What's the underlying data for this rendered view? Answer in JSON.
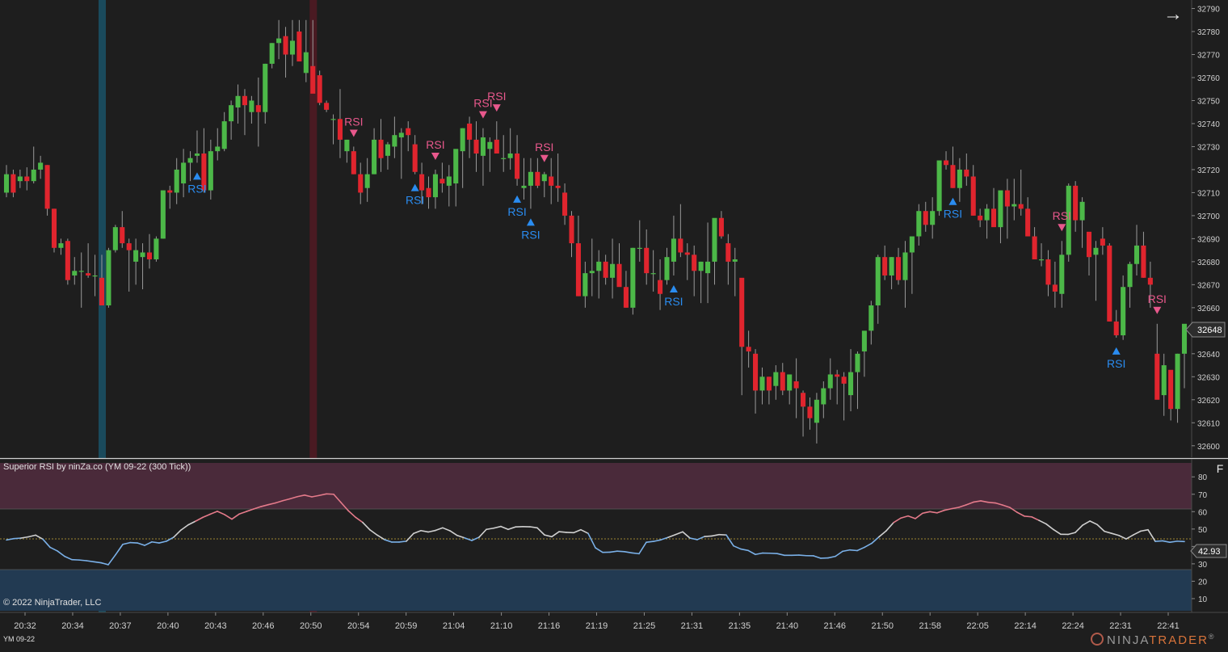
{
  "price_panel": {
    "y_ticks": [
      "32600",
      "32610",
      "32620",
      "32630",
      "32640",
      "32650",
      "32660",
      "32670",
      "32680",
      "32690",
      "32700",
      "32710",
      "32720",
      "32730",
      "32740",
      "32750",
      "32760",
      "32770",
      "32780",
      "32790"
    ],
    "current_price": "32648",
    "highlight_bands": [
      {
        "at_bar": 14,
        "color": "#1a4a5c"
      },
      {
        "at_bar": 45,
        "color": "#4a1a22"
      }
    ]
  },
  "indicator_panel": {
    "title": "Superior RSI by ninZa.co (YM 09-22 (300 Tick))",
    "y_ticks": [
      "10",
      "20",
      "30",
      "40",
      "50",
      "60",
      "70",
      "80"
    ],
    "current_value": "42.93",
    "overbought": 70,
    "oversold": 30,
    "midline": 50
  },
  "x_ticks": [
    "20:32",
    "20:34",
    "20:37",
    "20:40",
    "20:43",
    "20:46",
    "20:50",
    "20:54",
    "20:59",
    "21:04",
    "21:10",
    "21:16",
    "21:19",
    "21:25",
    "21:31",
    "21:35",
    "21:40",
    "21:46",
    "21:50",
    "21:58",
    "22:05",
    "22:14",
    "22:24",
    "22:31",
    "22:41"
  ],
  "signal_label": "RSI",
  "copyright": "© 2022 NinjaTrader, LLC",
  "instrument": "YM 09-22",
  "brand": {
    "main": "NINJA",
    "accent": "TRADER",
    "mark": "®"
  },
  "buttons": {
    "f_label": "F",
    "nav_arrow": "→"
  },
  "colors": {
    "up": "#4cb848",
    "down": "#e0252e",
    "buy_signal": "#2a8cf0",
    "sell_signal": "#e8588c",
    "rsi_high": "#e47a8a",
    "rsi_low": "#7ab0e8"
  },
  "chart_data": {
    "type": "candlestick",
    "series_price": {
      "name": "YM 09-22",
      "ohlc": [
        [
          32710,
          32722,
          32708,
          32718
        ],
        [
          32718,
          32720,
          32708,
          32710
        ],
        [
          32715,
          32720,
          32712,
          32717
        ],
        [
          32717,
          32721,
          32711,
          32715
        ],
        [
          32715,
          32730,
          32714,
          32720
        ],
        [
          32720,
          32726,
          32716,
          32723
        ],
        [
          32722,
          32722,
          32700,
          32703
        ],
        [
          32703,
          32703,
          32684,
          32686
        ],
        [
          32686,
          32690,
          32683,
          32688
        ],
        [
          32689,
          32690,
          32670,
          32672
        ],
        [
          32674,
          32682,
          32670,
          32676
        ],
        [
          32676,
          32684,
          32660,
          32676
        ],
        [
          32675,
          32688,
          32673,
          32674
        ],
        [
          32674,
          32683,
          32665,
          32674
        ],
        [
          32673,
          32683,
          32665,
          32661
        ],
        [
          32661,
          32686,
          32660,
          32685
        ],
        [
          32685,
          32696,
          32684,
          32695
        ],
        [
          32695,
          32702,
          32686,
          32688
        ],
        [
          32688,
          32690,
          32667,
          32685
        ],
        [
          32680,
          32690,
          32670,
          32685
        ],
        [
          32682,
          32688,
          32668,
          32684
        ],
        [
          32684,
          32692,
          32677,
          32681
        ],
        [
          32681,
          32691,
          32680,
          32690
        ],
        [
          32690,
          32711,
          32690,
          32711
        ],
        [
          32711,
          32713,
          32703,
          32710
        ],
        [
          32710,
          32725,
          32705,
          32720
        ],
        [
          32714,
          32729,
          32708,
          32723
        ],
        [
          32723,
          32728,
          32715,
          32725
        ],
        [
          32726,
          32737,
          32723,
          32727
        ],
        [
          32727,
          32738,
          32710,
          32711
        ],
        [
          32711,
          32733,
          32707,
          32728
        ],
        [
          32728,
          32738,
          32724,
          32730
        ],
        [
          32729,
          32745,
          32728,
          32741
        ],
        [
          32741,
          32750,
          32733,
          32748
        ],
        [
          32747,
          32757,
          32740,
          32752
        ],
        [
          32752,
          32755,
          32735,
          32748
        ],
        [
          32745,
          32752,
          32740,
          32750
        ],
        [
          32748,
          32760,
          32730,
          32745
        ],
        [
          32745,
          32766,
          32740,
          32766
        ],
        [
          32766,
          32775,
          32764,
          32775
        ],
        [
          32775,
          32785,
          32768,
          32777
        ],
        [
          32778,
          32782,
          32760,
          32770
        ],
        [
          32770,
          32785,
          32765,
          32776
        ],
        [
          32780,
          32785,
          32768,
          32767
        ],
        [
          32762,
          32785,
          32758,
          32771
        ],
        [
          32765,
          32785,
          32757,
          32753
        ],
        [
          32761,
          32763,
          32748,
          32749
        ],
        [
          32749,
          32750,
          32745,
          32746
        ],
        [
          32742,
          32744,
          32731,
          32742
        ],
        [
          32742,
          32755,
          32725,
          32733
        ],
        [
          32728,
          32733,
          32723,
          32733
        ],
        [
          32728,
          32730,
          32718,
          32718
        ],
        [
          32718,
          32723,
          32705,
          32710
        ],
        [
          32712,
          32725,
          32706,
          32718
        ],
        [
          32718,
          32738,
          32718,
          32733
        ],
        [
          32733,
          32742,
          32719,
          32725
        ],
        [
          32726,
          32732,
          32720,
          32731
        ],
        [
          32730,
          32743,
          32725,
          32735
        ],
        [
          32734,
          32738,
          32716,
          32736
        ],
        [
          32738,
          32741,
          32728,
          32735
        ],
        [
          32731,
          32735,
          32718,
          32719
        ],
        [
          32718,
          32723,
          32705,
          32711
        ],
        [
          32712,
          32717,
          32703,
          32708
        ],
        [
          32708,
          32720,
          32703,
          32718
        ],
        [
          32716,
          32723,
          32710,
          32714
        ],
        [
          32713,
          32722,
          32704,
          32717
        ],
        [
          32714,
          32727,
          32704,
          32729
        ],
        [
          32728,
          32738,
          32712,
          32738
        ],
        [
          32740,
          32743,
          32725,
          32733
        ],
        [
          32733,
          32741,
          32719,
          32727
        ],
        [
          32726,
          32738,
          32713,
          32734
        ],
        [
          32729,
          32734,
          32719,
          32732
        ],
        [
          32733,
          32741,
          32729,
          32727
        ],
        [
          32725,
          32735,
          32719,
          32725
        ],
        [
          32725,
          32738,
          32720,
          32727
        ],
        [
          32727,
          32735,
          32713,
          32716
        ],
        [
          32712,
          32725,
          32707,
          32713
        ],
        [
          32713,
          32725,
          32703,
          32719
        ],
        [
          32719,
          32725,
          32712,
          32713
        ],
        [
          32715,
          32719,
          32708,
          32718
        ],
        [
          32717,
          32725,
          32705,
          32713
        ],
        [
          32713,
          32727,
          32706,
          32712
        ],
        [
          32710,
          32714,
          32696,
          32700
        ],
        [
          32700,
          32702,
          32682,
          32688
        ],
        [
          32688,
          32700,
          32665,
          32665
        ],
        [
          32665,
          32680,
          32660,
          32675
        ],
        [
          32675,
          32690,
          32665,
          32676
        ],
        [
          32676,
          32685,
          32664,
          32680
        ],
        [
          32680,
          32683,
          32670,
          32673
        ],
        [
          32673,
          32690,
          32664,
          32679
        ],
        [
          32679,
          32688,
          32670,
          32669
        ],
        [
          32669,
          32676,
          32660,
          32660
        ],
        [
          32660,
          32686,
          32657,
          32686
        ],
        [
          32686,
          32698,
          32680,
          32686
        ],
        [
          32686,
          32694,
          32670,
          32675
        ],
        [
          32675,
          32685,
          32667,
          32675
        ],
        [
          32672,
          32681,
          32659,
          32666
        ],
        [
          32672,
          32686,
          32670,
          32682
        ],
        [
          32680,
          32700,
          32674,
          32690
        ],
        [
          32690,
          32705,
          32682,
          32684
        ],
        [
          32684,
          32688,
          32672,
          32683
        ],
        [
          32683,
          32687,
          32665,
          32676
        ],
        [
          32676,
          32680,
          32662,
          32680
        ],
        [
          32675,
          32697,
          32662,
          32680
        ],
        [
          32680,
          32696,
          32670,
          32699
        ],
        [
          32699,
          32702,
          32690,
          32691
        ],
        [
          32688,
          32692,
          32670,
          32680
        ],
        [
          32680,
          32686,
          32665,
          32681
        ],
        [
          32673,
          32670,
          32622,
          32643
        ],
        [
          32643,
          32650,
          32634,
          32641
        ],
        [
          32640,
          32642,
          32614,
          32624
        ],
        [
          32624,
          32634,
          32618,
          32630
        ],
        [
          32630,
          32630,
          32618,
          32624
        ],
        [
          32626,
          32635,
          32620,
          32632
        ],
        [
          32632,
          32636,
          32622,
          32624
        ],
        [
          32624,
          32628,
          32618,
          32631
        ],
        [
          32628,
          32638,
          32612,
          32625
        ],
        [
          32623,
          32624,
          32604,
          32617
        ],
        [
          32617,
          32621,
          32607,
          32612
        ],
        [
          32610,
          32623,
          32601,
          32620
        ],
        [
          32618,
          32628,
          32612,
          32625
        ],
        [
          32625,
          32638,
          32620,
          32631
        ],
        [
          32631,
          32633,
          32618,
          32630
        ],
        [
          32630,
          32632,
          32611,
          32627
        ],
        [
          32622,
          32642,
          32615,
          32632
        ],
        [
          32632,
          32641,
          32616,
          32640
        ],
        [
          32641,
          32648,
          32630,
          32650
        ],
        [
          32650,
          32663,
          32644,
          32661
        ],
        [
          32661,
          32683,
          32653,
          32682
        ],
        [
          32682,
          32687,
          32672,
          32674
        ],
        [
          32674,
          32682,
          32668,
          32682
        ],
        [
          32682,
          32686,
          32670,
          32672
        ],
        [
          32672,
          32689,
          32660,
          32684
        ],
        [
          32684,
          32690,
          32666,
          32691
        ],
        [
          32691,
          32705,
          32687,
          32702
        ],
        [
          32702,
          32706,
          32693,
          32696
        ],
        [
          32696,
          32708,
          32690,
          32702
        ],
        [
          32702,
          32712,
          32700,
          32724
        ],
        [
          32724,
          32728,
          32720,
          32722
        ],
        [
          32722,
          32730,
          32712,
          32712
        ],
        [
          32712,
          32725,
          32706,
          32720
        ],
        [
          32720,
          32727,
          32713,
          32717
        ],
        [
          32717,
          32722,
          32700,
          32700
        ],
        [
          32700,
          32703,
          32695,
          32698
        ],
        [
          32698,
          32705,
          32690,
          32703
        ],
        [
          32703,
          32712,
          32697,
          32695
        ],
        [
          32695,
          32705,
          32688,
          32711
        ],
        [
          32711,
          32716,
          32690,
          32704
        ],
        [
          32704,
          32716,
          32698,
          32705
        ],
        [
          32705,
          32720,
          32700,
          32703
        ],
        [
          32703,
          32708,
          32692,
          32691
        ],
        [
          32691,
          32695,
          32683,
          32681
        ],
        [
          32681,
          32688,
          32678,
          32681
        ],
        [
          32681,
          32685,
          32665,
          32670
        ],
        [
          32670,
          32680,
          32660,
          32667
        ],
        [
          32666,
          32689,
          32660,
          32683
        ],
        [
          32683,
          32714,
          32680,
          32713
        ],
        [
          32713,
          32715,
          32693,
          32698
        ],
        [
          32698,
          32708,
          32686,
          32706
        ],
        [
          32693,
          32692,
          32674,
          32682
        ],
        [
          32683,
          32689,
          32663,
          32686
        ],
        [
          32690,
          32695,
          32683,
          32687
        ],
        [
          32687,
          32688,
          32654,
          32654
        ],
        [
          32654,
          32659,
          32647,
          32648
        ],
        [
          32648,
          32674,
          32646,
          32669
        ],
        [
          32669,
          32680,
          32660,
          32679
        ],
        [
          32679,
          32696,
          32674,
          32687
        ],
        [
          32687,
          32693,
          32673,
          32673
        ],
        [
          32673,
          32680,
          32660,
          32670
        ],
        [
          32640,
          32653,
          32625,
          32620
        ],
        [
          32622,
          32640,
          32613,
          32635
        ],
        [
          32633,
          32630,
          32611,
          32616
        ],
        [
          32616,
          32640,
          32610,
          32640
        ],
        [
          32640,
          32648,
          32625,
          32653
        ]
      ]
    },
    "series_rsi": {
      "name": "Superior RSI",
      "values": [
        43.7,
        44.5,
        44.8,
        45.5,
        46.5,
        44.2,
        39.5,
        37.4,
        34.3,
        32.4,
        32.2,
        31.8,
        31.2,
        30.6,
        29.5,
        35.2,
        41.2,
        42.2,
        42.0,
        40.6,
        42.6,
        42.0,
        43.0,
        45.3,
        49.4,
        52.4,
        54.5,
        56.7,
        58.5,
        60.2,
        58.3,
        55.7,
        58.6,
        60.1,
        61.5,
        62.9,
        64.0,
        65.0,
        66.3,
        67.4,
        68.6,
        69.5,
        68.5,
        69.3,
        70.2,
        70.0,
        65.3,
        60.6,
        56.8,
        53.8,
        49.5,
        46.5,
        43.9,
        42.5,
        42.5,
        43.0,
        47.5,
        49.1,
        48.3,
        49.2,
        50.7,
        49.0,
        46.3,
        44.9,
        43.4,
        45.3,
        49.8,
        50.5,
        51.5,
        49.8,
        51.2,
        51.4,
        51.3,
        50.7,
        46.6,
        45.6,
        48.5,
        48.1,
        47.9,
        49.6,
        47.5,
        39.2,
        36.6,
        36.7,
        37.3,
        37.0,
        36.3,
        35.8,
        42.4,
        42.9,
        43.8,
        45.2,
        46.8,
        48.4,
        44.8,
        43.9,
        45.7,
        46.0,
        46.8,
        46.6,
        40.3,
        38.5,
        37.7,
        35.4,
        36.2,
        36.1,
        35.9,
        34.9,
        34.9,
        35.0,
        34.7,
        34.6,
        33.2,
        33.4,
        34.3,
        37.2,
        38.0,
        37.6,
        39.5,
        41.8,
        45.5,
        49.0,
        53.7,
        56.3,
        57.5,
        56.0,
        59.1,
        60.0,
        59.3,
        60.8,
        61.7,
        62.5,
        63.9,
        65.5,
        66.2,
        65.4,
        65.0,
        63.8,
        62.4,
        59.6,
        57.4,
        57.0,
        55.0,
        52.9,
        49.7,
        47.0,
        46.9,
        48.0,
        52.2,
        54.6,
        52.6,
        48.7,
        47.5,
        46.3,
        44.3,
        46.7,
        48.8,
        49.6,
        42.9,
        43.2,
        42.4,
        43.0,
        42.8
      ]
    },
    "signals": {
      "buy": [
        28,
        75,
        77,
        60,
        98,
        139,
        163
      ],
      "sell": [
        51,
        63,
        72,
        70,
        79,
        155,
        169
      ]
    },
    "y_range": [
      32595,
      32793
    ],
    "rsi_range": [
      3,
      88
    ]
  }
}
